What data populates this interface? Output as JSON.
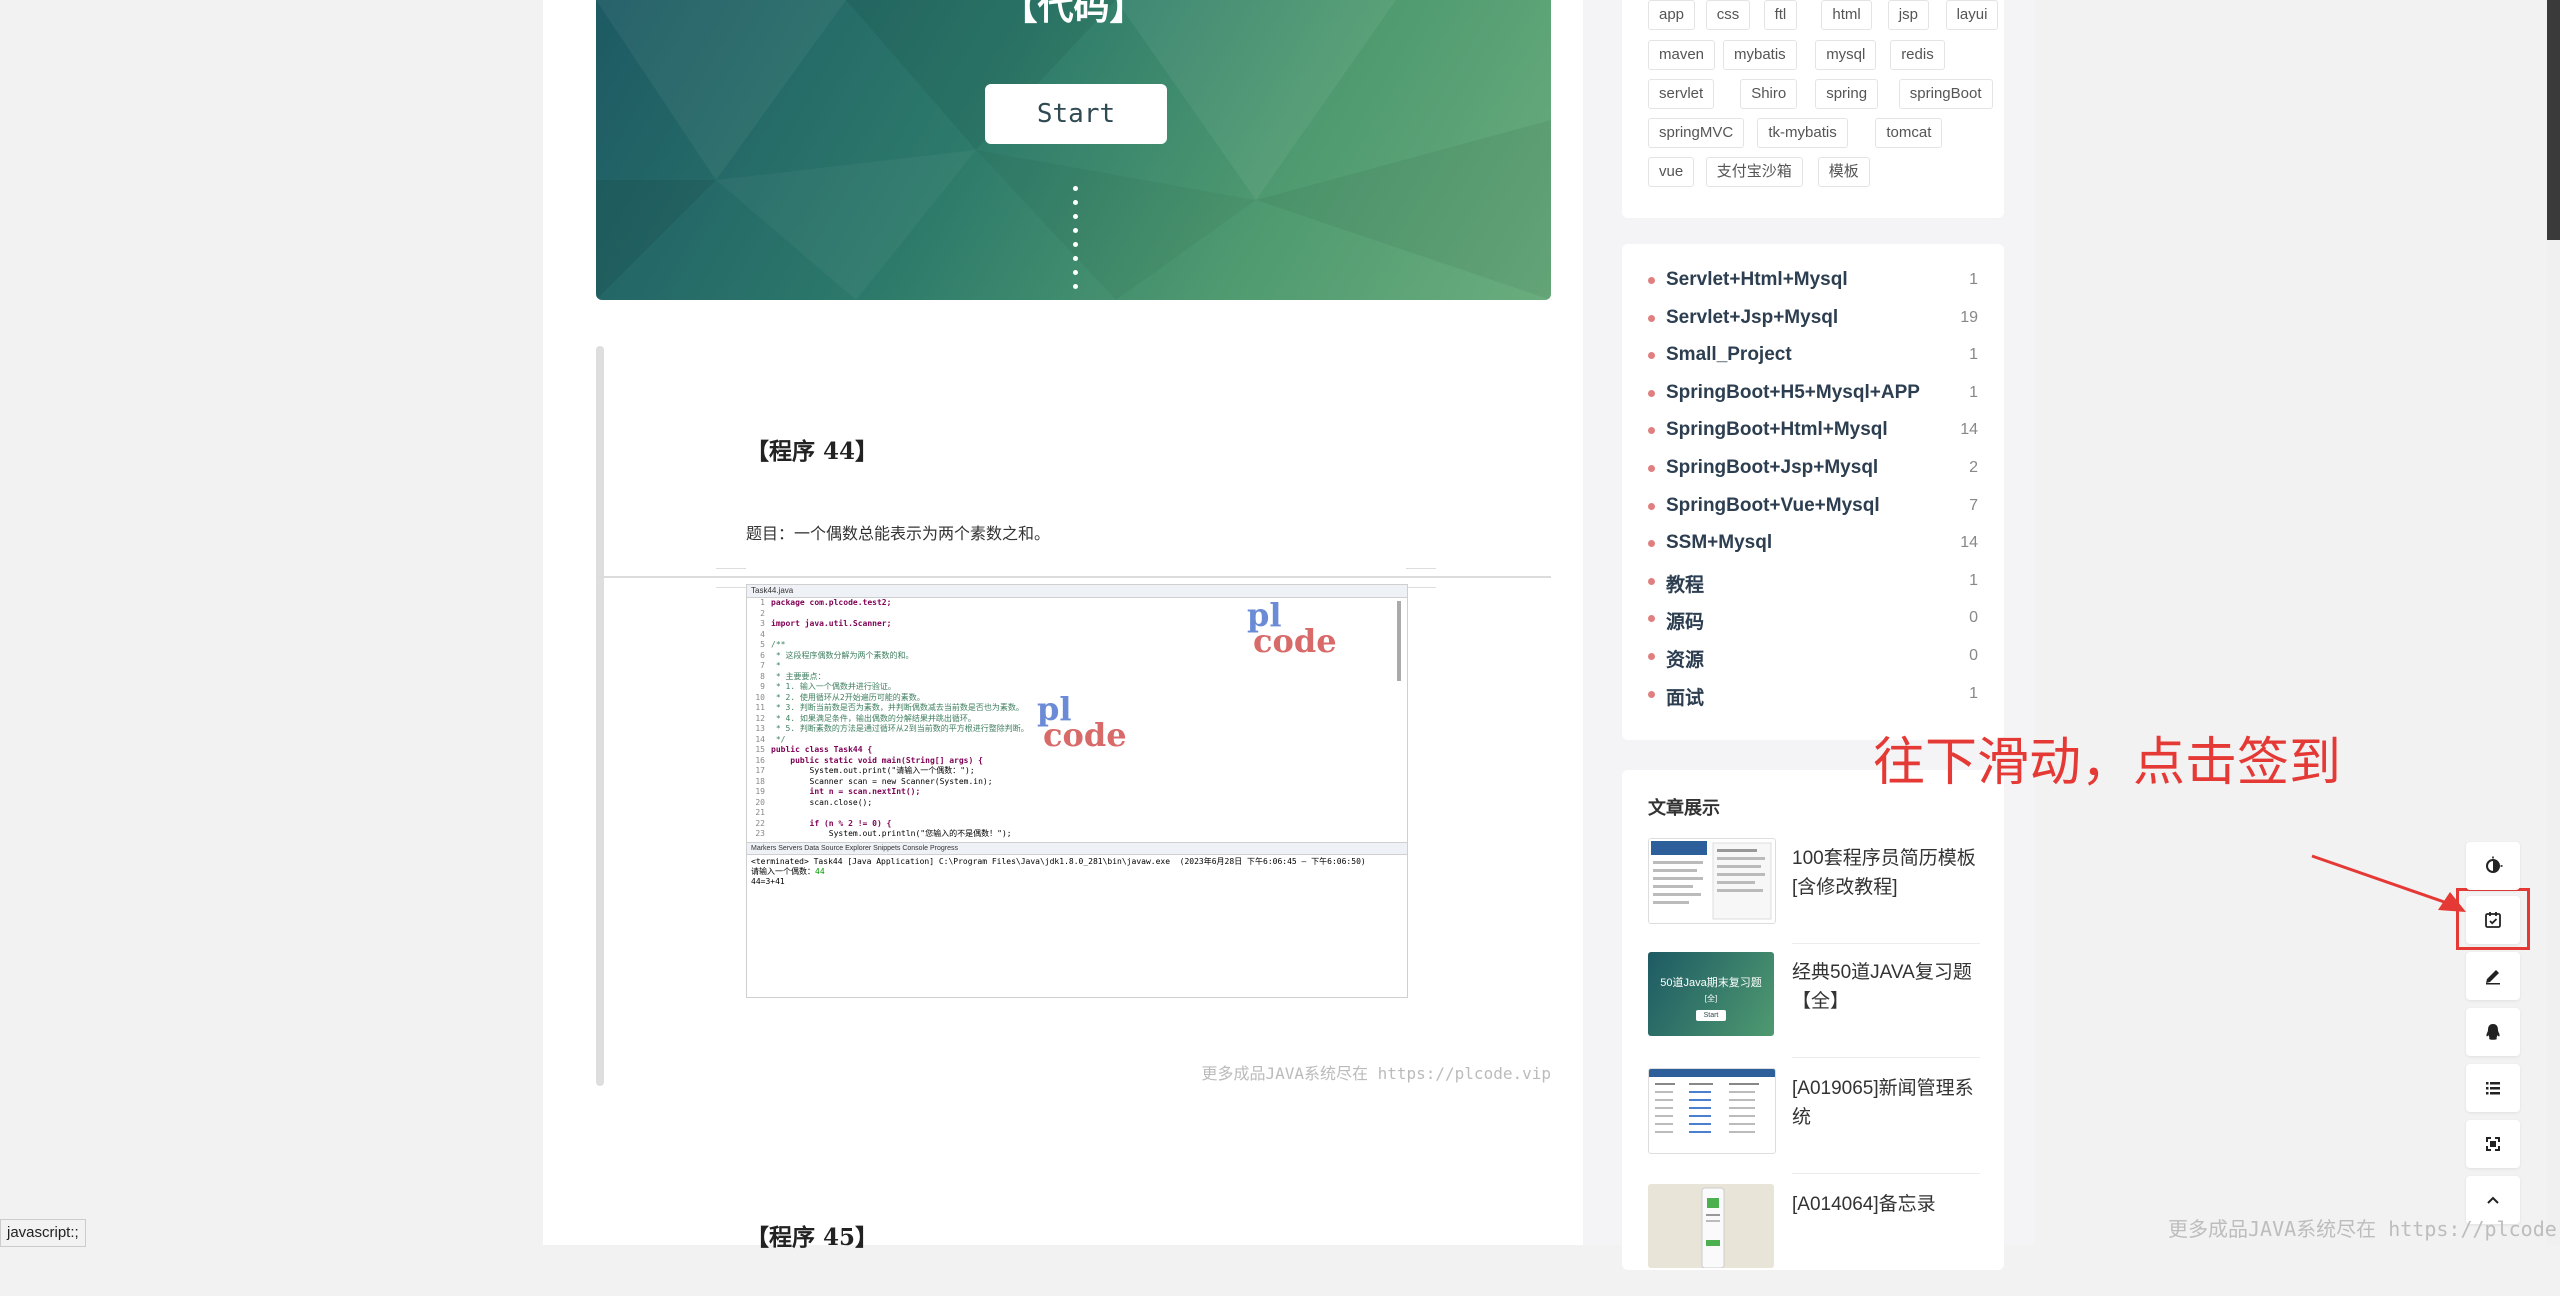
{
  "hero": {
    "title": "【代码】",
    "start_label": "Start"
  },
  "article": {
    "program_title": "【程序 44】",
    "description": "题目：一个偶数总能表示为两个素数之和。",
    "footer_note": "更多成品JAVA系统尽在 https://plcode.vip",
    "next_program_title": "【程序 45】",
    "code": {
      "tab": "Task44.java",
      "lines": [
        "package com.plcode.test2;",
        "",
        "import java.util.Scanner;",
        "",
        "/**",
        " * 这段程序偶数分解为两个素数的和。",
        " *",
        " * 主要要点：",
        " * 1. 输入一个偶数并进行验证。",
        " * 2. 使用循环从2开始遍历可能的素数。",
        " * 3. 判断当前数是否为素数，并判断偶数减去当前数是否也为素数。",
        " * 4. 如果满足条件，输出偶数的分解结果并跳出循环。",
        " * 5. 判断素数的方法是通过循环从2到当前数的平方根进行整除判断。",
        " */",
        "public class Task44 {",
        "    public static void main(String[] args) {",
        "        System.out.print(\"请输入一个偶数：\");",
        "        Scanner scan = new Scanner(System.in);",
        "        int n = scan.nextInt();",
        "        scan.close();",
        "",
        "        if (n % 2 != 0) {",
        "            System.out.println(\"您输入的不是偶数！\");"
      ],
      "console_tabs": "Markers  Servers  Data Source Explorer  Snippets  Console  Progress",
      "console_header": "<terminated> Task44 [Java Application] C:\\Program Files\\Java\\jdk1.8.0_281\\bin\\javaw.exe  (2023年6月28日 下午6:06:45 – 下午6:06:50)",
      "console_prompt": "请输入一个偶数：",
      "console_input": "44",
      "console_output": "44=3+41",
      "watermark_p": "pl",
      "watermark_c": "code"
    }
  },
  "tags": [
    "app",
    "css",
    "ftl",
    "html",
    "jsp",
    "layui",
    "maven",
    "mybatis",
    "mysql",
    "redis",
    "servlet",
    "Shiro",
    "spring",
    "springBoot",
    "springMVC",
    "tk-mybatis",
    "tomcat",
    "vue",
    "支付宝沙箱",
    "模板"
  ],
  "categories": [
    {
      "name": "Servlet+Html+Mysql",
      "count": "1"
    },
    {
      "name": "Servlet+Jsp+Mysql",
      "count": "19"
    },
    {
      "name": "Small_Project",
      "count": "1"
    },
    {
      "name": "SpringBoot+H5+Mysql+APP",
      "count": "1"
    },
    {
      "name": "SpringBoot+Html+Mysql",
      "count": "14"
    },
    {
      "name": "SpringBoot+Jsp+Mysql",
      "count": "2"
    },
    {
      "name": "SpringBoot+Vue+Mysql",
      "count": "7"
    },
    {
      "name": "SSM+Mysql",
      "count": "14"
    },
    {
      "name": "教程",
      "count": "1"
    },
    {
      "name": "源码",
      "count": "0"
    },
    {
      "name": "资源",
      "count": "0"
    },
    {
      "name": "面试",
      "count": "1"
    }
  ],
  "posts": {
    "title": "文章展示",
    "items": [
      {
        "title": "100套程序员简历模板[含修改教程]"
      },
      {
        "title": "经典50道JAVA复习题【全】",
        "thumb_text": "50道Java期末复习题",
        "thumb_sub": "[全]",
        "thumb_btn": "Start"
      },
      {
        "title": "[A019065]新闻管理系统"
      },
      {
        "title": "[A014064]备忘录"
      }
    ]
  },
  "annotation": {
    "text": "往下滑动，点击签到"
  },
  "toolbar": [
    "theme-toggle-icon",
    "checkin-icon",
    "edit-icon",
    "qq-icon",
    "list-icon",
    "fullscreen-icon",
    "back-to-top-icon"
  ],
  "status_bar": "javascript:;",
  "bottom_watermark": "更多成品JAVA系统尽在 https://plcode.vip",
  "colors": {
    "accent_red": "#e53935",
    "category_dot": "#e07f7f",
    "hero_start": "#1d5a64",
    "hero_end": "#6aad7e"
  }
}
